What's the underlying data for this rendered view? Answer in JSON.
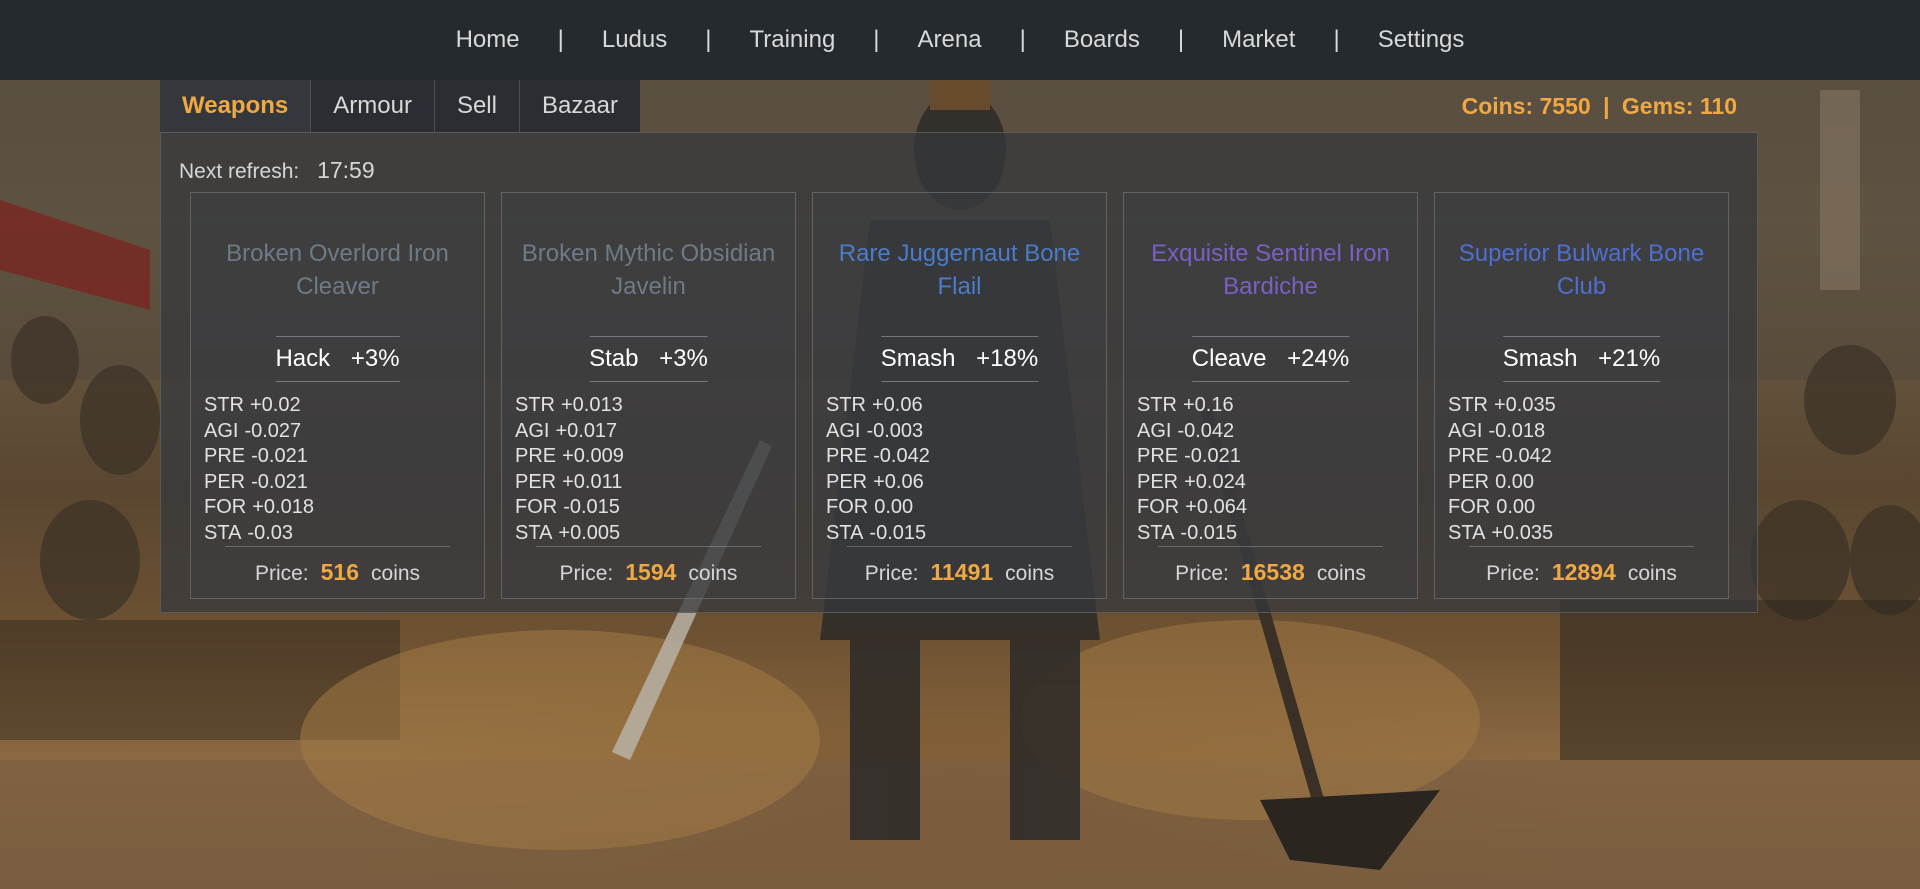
{
  "nav": {
    "items": [
      "Home",
      "Ludus",
      "Training",
      "Arena",
      "Boards",
      "Market",
      "Settings"
    ],
    "separator": "|"
  },
  "tabs": [
    {
      "label": "Weapons",
      "active": true
    },
    {
      "label": "Armour",
      "active": false
    },
    {
      "label": "Sell",
      "active": false
    },
    {
      "label": "Bazaar",
      "active": false
    }
  ],
  "currency": {
    "coins_label": "Coins: 7550",
    "separator": "|",
    "gems_label": "Gems: 110"
  },
  "refresh": {
    "label": "Next refresh:",
    "time": "17:59"
  },
  "colors": {
    "accent": "#f0a942",
    "rarity_broken": "#6f7a86",
    "rarity_rare": "#4a7cc9",
    "rarity_exquisite": "#7a5fc4",
    "rarity_superior": "#4f6fd0"
  },
  "weapons": [
    {
      "name": "Broken Overlord Iron Cleaver",
      "name_color": "#6f7a86",
      "attack": "Hack",
      "bonus": "+3%",
      "stats": [
        {
          "key": "STR",
          "val": "+0.02"
        },
        {
          "key": "AGI",
          "val": "-0.027"
        },
        {
          "key": "PRE",
          "val": "-0.021"
        },
        {
          "key": "PER",
          "val": "-0.021"
        },
        {
          "key": "FOR",
          "val": "+0.018"
        },
        {
          "key": "STA",
          "val": "-0.03"
        }
      ],
      "price_label": "Price:",
      "price": "516",
      "currency_unit": "coins"
    },
    {
      "name": "Broken Mythic Obsidian Javelin",
      "name_color": "#6f7a86",
      "attack": "Stab",
      "bonus": "+3%",
      "stats": [
        {
          "key": "STR",
          "val": "+0.013"
        },
        {
          "key": "AGI",
          "val": "+0.017"
        },
        {
          "key": "PRE",
          "val": "+0.009"
        },
        {
          "key": "PER",
          "val": "+0.011"
        },
        {
          "key": "FOR",
          "val": "-0.015"
        },
        {
          "key": "STA",
          "val": "+0.005"
        }
      ],
      "price_label": "Price:",
      "price": "1594",
      "currency_unit": "coins"
    },
    {
      "name": "Rare Juggernaut Bone Flail",
      "name_color": "#4a7cc9",
      "attack": "Smash",
      "bonus": "+18%",
      "stats": [
        {
          "key": "STR",
          "val": "+0.06"
        },
        {
          "key": "AGI",
          "val": "-0.003"
        },
        {
          "key": "PRE",
          "val": "-0.042"
        },
        {
          "key": "PER",
          "val": "+0.06"
        },
        {
          "key": "FOR",
          "val": "0.00"
        },
        {
          "key": "STA",
          "val": "-0.015"
        }
      ],
      "price_label": "Price:",
      "price": "11491",
      "currency_unit": "coins"
    },
    {
      "name": "Exquisite Sentinel Iron Bardiche",
      "name_color": "#7a5fc4",
      "attack": "Cleave",
      "bonus": "+24%",
      "stats": [
        {
          "key": "STR",
          "val": "+0.16"
        },
        {
          "key": "AGI",
          "val": "-0.042"
        },
        {
          "key": "PRE",
          "val": "-0.021"
        },
        {
          "key": "PER",
          "val": "+0.024"
        },
        {
          "key": "FOR",
          "val": "+0.064"
        },
        {
          "key": "STA",
          "val": "-0.015"
        }
      ],
      "price_label": "Price:",
      "price": "16538",
      "currency_unit": "coins"
    },
    {
      "name": "Superior Bulwark Bone Club",
      "name_color": "#4f6fd0",
      "attack": "Smash",
      "bonus": "+21%",
      "stats": [
        {
          "key": "STR",
          "val": "+0.035"
        },
        {
          "key": "AGI",
          "val": "-0.018"
        },
        {
          "key": "PRE",
          "val": "-0.042"
        },
        {
          "key": "PER",
          "val": "0.00"
        },
        {
          "key": "FOR",
          "val": "0.00"
        },
        {
          "key": "STA",
          "val": "+0.035"
        }
      ],
      "price_label": "Price:",
      "price": "12894",
      "currency_unit": "coins"
    }
  ]
}
